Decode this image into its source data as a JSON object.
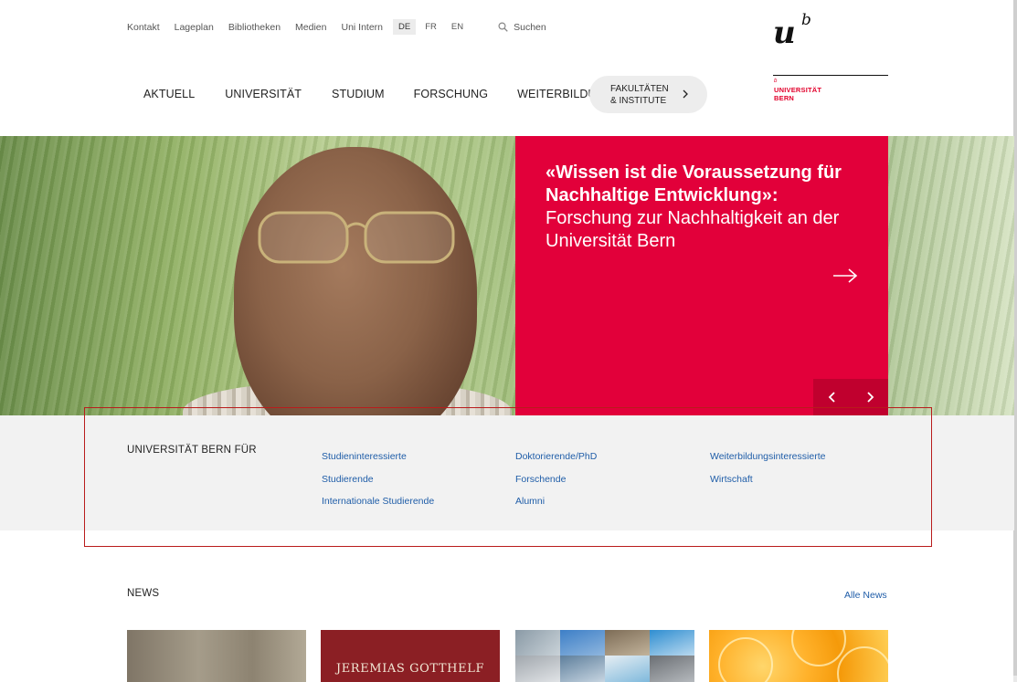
{
  "util_nav": {
    "links": [
      "Kontakt",
      "Lageplan",
      "Bibliotheken",
      "Medien",
      "Uni Intern"
    ],
    "languages": [
      "DE",
      "FR",
      "EN"
    ],
    "active_language": "DE",
    "search_label": "Suchen"
  },
  "logo": {
    "letter": "u",
    "superscript": "b",
    "small_b": "b",
    "name_line1": "UNIVERSITÄT",
    "name_line2": "BERN"
  },
  "main_nav": {
    "items": [
      "AKTUELL",
      "UNIVERSITÄT",
      "STUDIUM",
      "FORSCHUNG",
      "WEITERBILDUNG"
    ],
    "faculties_line1": "FAKULTÄTEN",
    "faculties_line2": "& INSTITUTE"
  },
  "hero": {
    "title_line1": "«Wissen ist die Voraussetzung für",
    "title_line2": "Nachhaltige Entwicklung»:",
    "subtitle_line1": "Forschung zur Nachhaltigkeit an der",
    "subtitle_line2": "Universität Bern"
  },
  "audience": {
    "title": "UNIVERSITÄT BERN FÜR",
    "col1": [
      "Studieninteressierte",
      "Studierende",
      "Internationale Studierende"
    ],
    "col2": [
      "Doktorierende/PhD",
      "Forschende",
      "Alumni"
    ],
    "col3": [
      "Weiterbildungsinteressierte",
      "Wirtschaft"
    ]
  },
  "news": {
    "title": "NEWS",
    "all_label": "Alle News",
    "thumb2_text": "JEREMIAS GOTTHELF"
  },
  "colors": {
    "accent_red": "#e2003a",
    "link_blue": "#1f5da8",
    "highlight_border": "#b91c1c"
  }
}
